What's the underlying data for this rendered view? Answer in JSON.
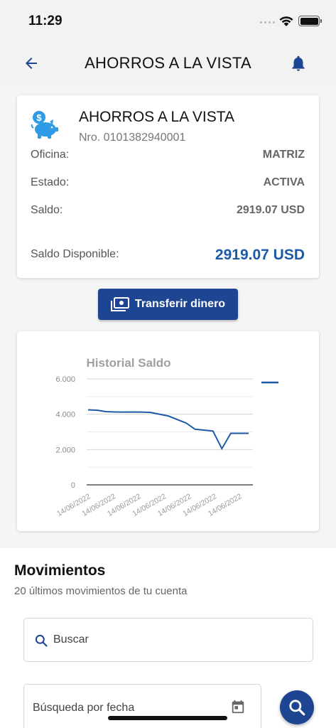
{
  "status_bar": {
    "time": "11:29"
  },
  "app_bar": {
    "title": "AHORROS A LA VISTA"
  },
  "account": {
    "name": "AHORROS A LA VISTA",
    "number": "Nro. 0101382940001",
    "rows": [
      {
        "label": "Oficina:",
        "value": "MATRIZ"
      },
      {
        "label": "Estado:",
        "value": "ACTIVA"
      },
      {
        "label": "Saldo:",
        "value": "2919.07 USD"
      }
    ],
    "available_label": "Saldo Disponible:",
    "available_value": "2919.07 USD"
  },
  "transfer_button": {
    "label": "Transferir dinero"
  },
  "chart_data": {
    "type": "line",
    "title": "Historial Saldo",
    "xlabel": "",
    "ylabel": "",
    "ylim": [
      0,
      6000
    ],
    "yticks": [
      "0",
      "2.000",
      "4.000",
      "6.000"
    ],
    "x_tick_labels": [
      "14/06/2022",
      "14/06/2022",
      "14/06/2022",
      "14/06/2022",
      "14/06/2022",
      "14/06/2022",
      "14/06/2022"
    ],
    "legend_position": "right",
    "grid": true,
    "series": [
      {
        "color": "#1d5aa6",
        "values": [
          4250,
          4230,
          4150,
          4130,
          4120,
          4130,
          4120,
          4100,
          4000,
          3900,
          3700,
          3500,
          3150,
          3100,
          3050,
          2050,
          2920,
          2920,
          2919
        ]
      }
    ]
  },
  "movements": {
    "title": "Movimientos",
    "subtitle": "20 últimos movimientos de tu cuenta",
    "search_placeholder": "Buscar",
    "date_label": "Búsqueda por fecha"
  },
  "colors": {
    "primary": "#1e4591",
    "accent_text": "#1d5aa6",
    "icon_blue": "#2e9be6"
  }
}
